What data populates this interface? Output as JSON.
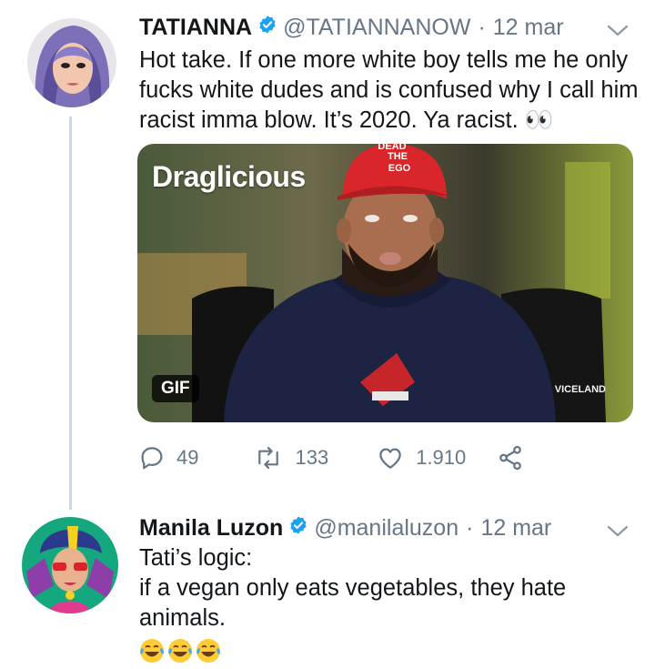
{
  "tweet1": {
    "name": "TATIANNA",
    "handle": "@TATIANNANOW",
    "separator": "·",
    "date": "12 mar",
    "text_lines": [
      "Hot take. If one more white boy tells me he only",
      "fucks white dudes and is confused why I call him",
      "racist imma blow. It’s 2020. Ya racist. 👀"
    ],
    "media": {
      "brand": "Draglicious",
      "gif_label": "GIF",
      "watermark": "VICELAND",
      "cap_lines": [
        "DEAD",
        "THE",
        "EGO"
      ]
    },
    "actions": {
      "replies": "49",
      "retweets": "133",
      "likes": "1.910"
    },
    "icons": [
      "verified-badge-icon",
      "chevron-down-icon",
      "reply-icon",
      "retweet-icon",
      "heart-icon",
      "share-icon"
    ]
  },
  "tweet2": {
    "name": "Manila Luzon",
    "handle": "@manilaluzon",
    "separator": "·",
    "date": "12 mar",
    "text_lines": [
      "Tati’s logic:",
      "if a vegan only eats vegetables, they hate",
      "animals."
    ],
    "emoji_names": [
      "tears-of-joy-emoji",
      "tears-of-joy-emoji",
      "tears-of-joy-emoji"
    ]
  },
  "colors": {
    "verified": "#1da1f2",
    "secondary_text": "#657786",
    "thread_line": "#cfd9de",
    "icon_gray": "#657786"
  }
}
